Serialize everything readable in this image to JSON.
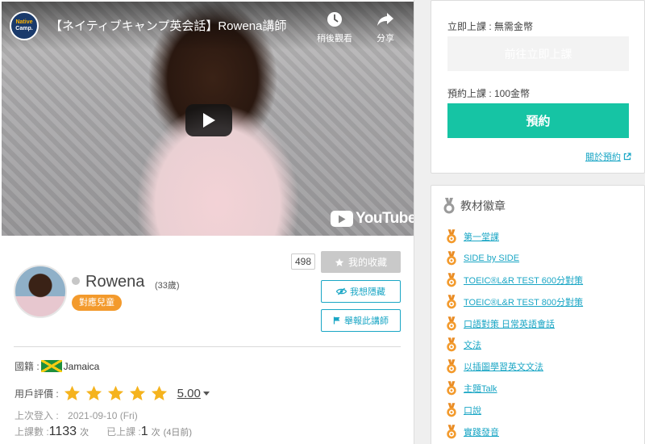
{
  "video": {
    "channel_logo_top": "ネイティブキャンプ英会話",
    "channel_logo_line1": "Native",
    "channel_logo_line2": "Camp.",
    "title": "【ネイティブキャンプ英会話】Rowena講師",
    "watch_later_label": "稍後觀看",
    "share_label": "分享",
    "youtube_logo": "YouTube"
  },
  "profile": {
    "name": "Rowena",
    "age": "(33歲)",
    "kids_badge": "對應兒童",
    "favorite_count": "498",
    "favorite_button": "我的收藏",
    "hide_button": "我想隱藏",
    "report_button": "舉報此講師"
  },
  "info": {
    "nationality_label": "國籍 :",
    "nationality": "Jamaica",
    "rating_label": "用戶評價 :",
    "rating_value": "5.00",
    "rating_stars": 5,
    "last_login_label": "上次登入 :",
    "last_login": "2021-09-10 (Fri)",
    "lessons_label": "上課數 :",
    "lessons_count": "1133",
    "lessons_unit": "次",
    "last_lesson_label": "已上課 :",
    "last_lesson_count": "1",
    "last_lesson_unit": "次",
    "last_lesson_ago": "(4日前)"
  },
  "booking": {
    "instant_label": "立即上課 : 無需金幣",
    "instant_button": "前往立即上課",
    "reserve_label": "預約上課 : 100金幣",
    "reserve_button": "預約",
    "about_link": "關於預約"
  },
  "badges": {
    "title": "教材徽章",
    "items": [
      {
        "label": "第一堂課"
      },
      {
        "label": "SIDE by SIDE"
      },
      {
        "label": "TOEIC®L&R TEST 600分對策"
      },
      {
        "label": "TOEIC®L&R TEST 800分對策"
      },
      {
        "label": "口語對策 日常英語會話"
      },
      {
        "label": "文法"
      },
      {
        "label": "以插圖學習英文文法"
      },
      {
        "label": "主題Talk"
      },
      {
        "label": "口說"
      },
      {
        "label": "實踐發音"
      }
    ]
  },
  "colors": {
    "accent_teal": "#1aa6c5",
    "reserve_green": "#16c4a4",
    "badge_orange": "#f39a2c",
    "star_yellow": "#f5b31e"
  }
}
